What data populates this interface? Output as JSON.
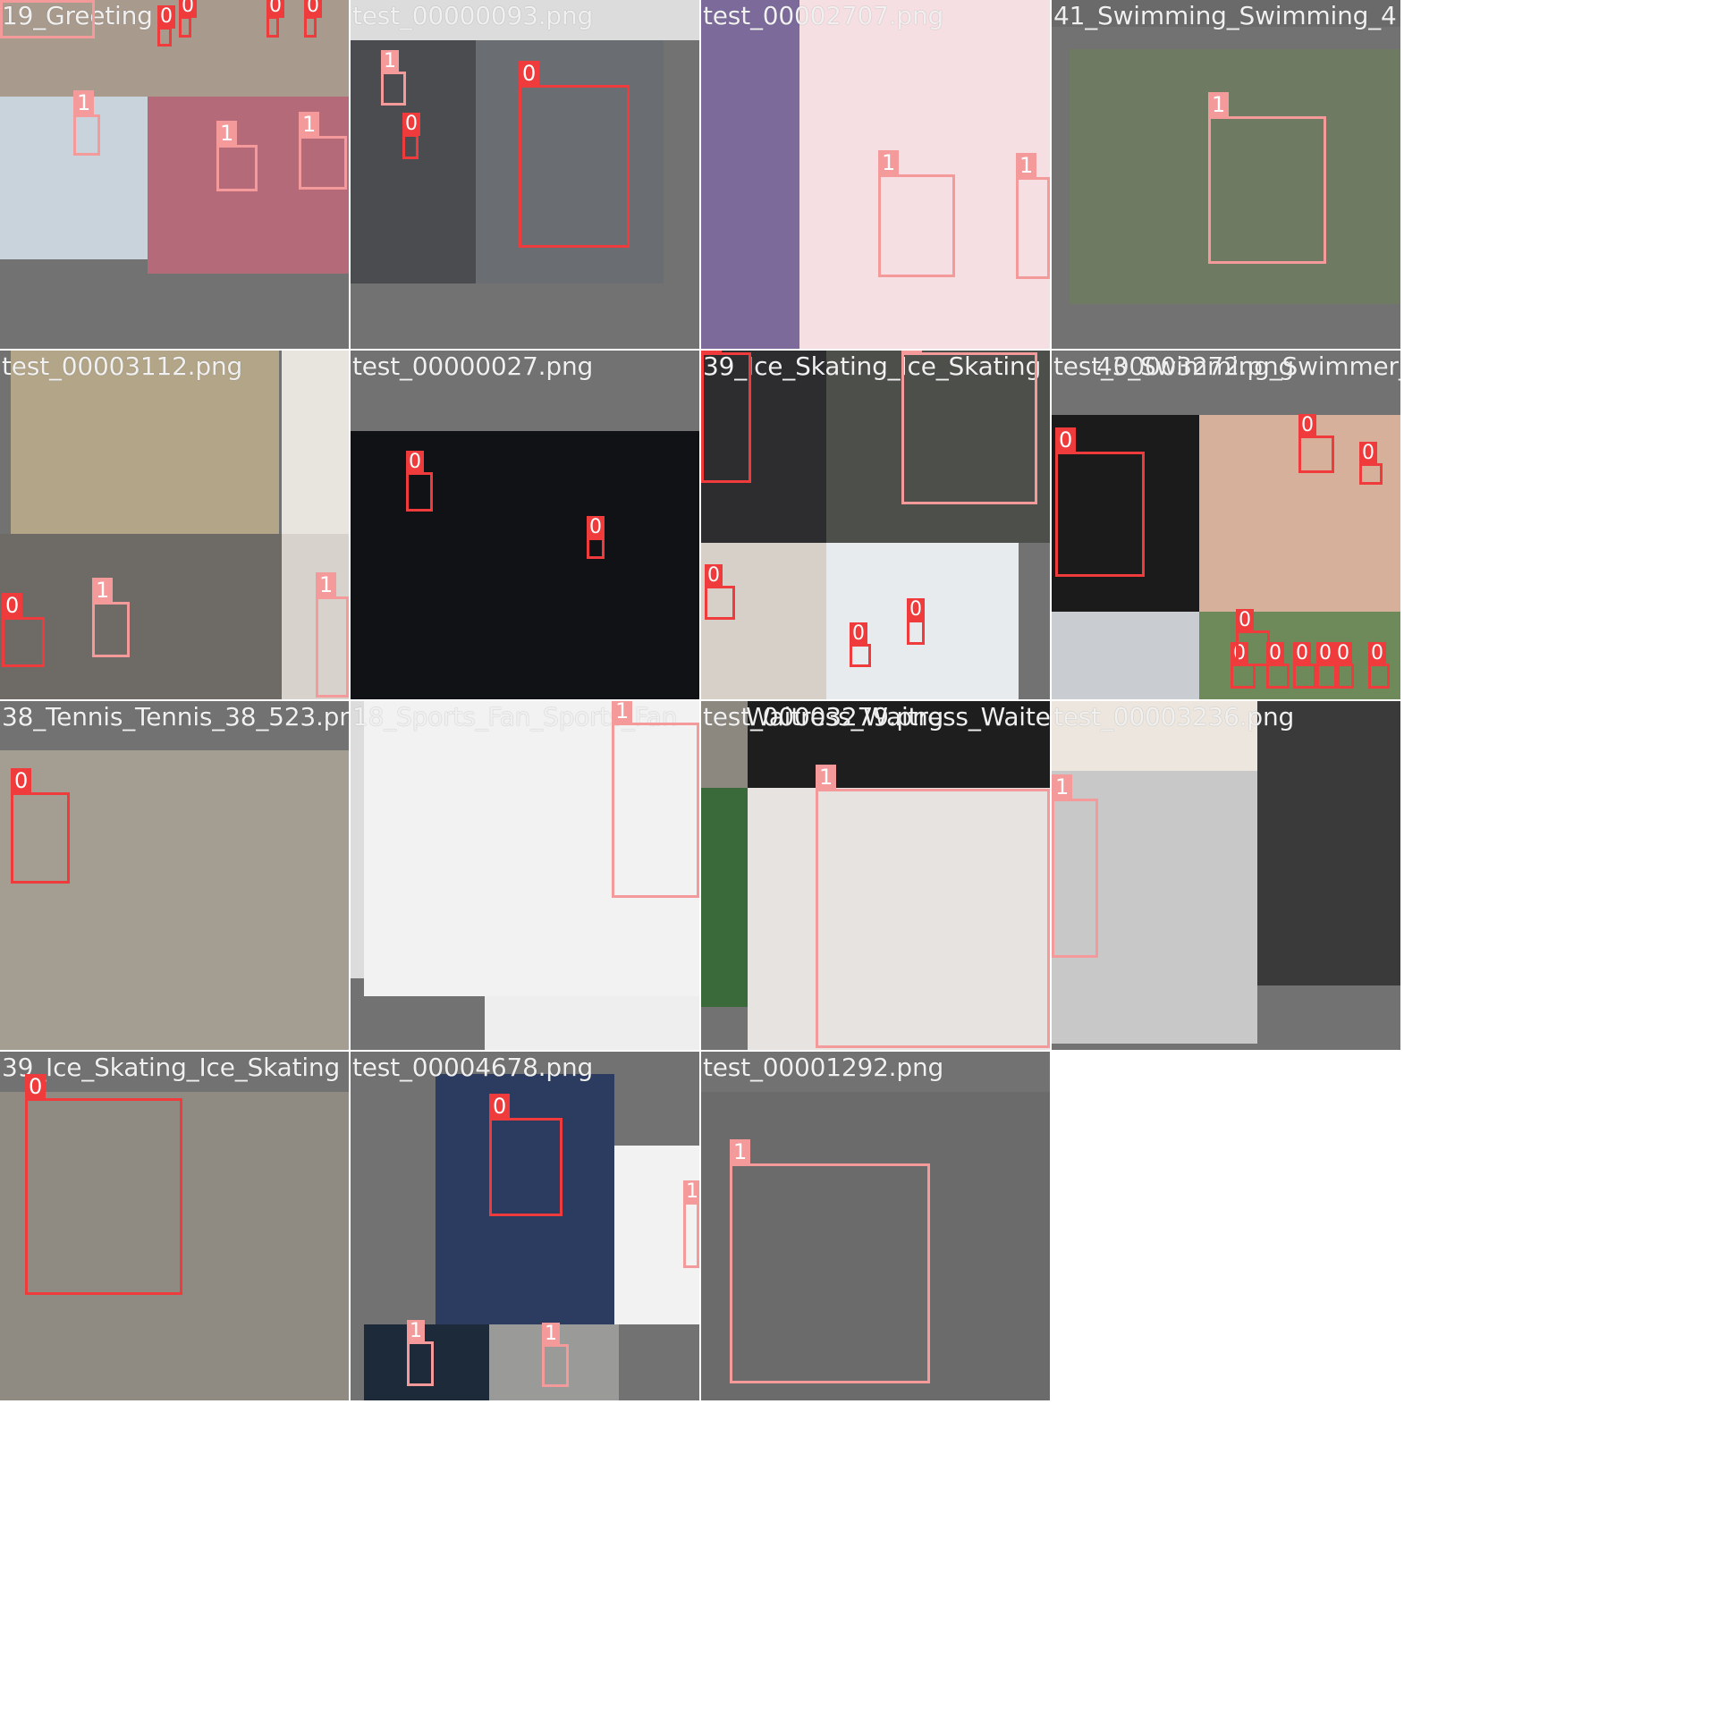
{
  "mosaic": {
    "classes": {
      "0": "0",
      "1": "1"
    },
    "colors": {
      "class_0": "#ef3b3b",
      "class_1": "#f49a9a",
      "padding_gray": "#727272"
    },
    "tiles": [
      {
        "row": 0,
        "col": 0,
        "titles": [
          "19_Greeting"
        ],
        "boxes": [
          "1",
          "0",
          "0",
          "0",
          "0",
          "0",
          "1",
          "1",
          "1"
        ]
      },
      {
        "row": 0,
        "col": 1,
        "titles": [
          "test_00000093.png"
        ],
        "boxes": [
          "1",
          "0",
          "0"
        ]
      },
      {
        "row": 0,
        "col": 2,
        "titles": [
          "test_00002707.png"
        ],
        "boxes": [
          "1",
          "1"
        ]
      },
      {
        "row": 0,
        "col": 3,
        "titles": [
          "41_Swimming_Swimming_4"
        ],
        "boxes": [
          "1"
        ]
      },
      {
        "row": 1,
        "col": 0,
        "titles": [
          "test_00003112.png"
        ],
        "boxes": [
          "0",
          "1",
          "1"
        ]
      },
      {
        "row": 1,
        "col": 1,
        "titles": [
          "test_00000027.png"
        ],
        "boxes": [
          "0",
          "0"
        ]
      },
      {
        "row": 1,
        "col": 2,
        "titles": [
          "39_Ice_Skating_Ice_Skating"
        ],
        "boxes": [
          "0",
          "1",
          "0",
          "0",
          "0"
        ]
      },
      {
        "row": 1,
        "col": 3,
        "titles": [
          "test_00003272.png",
          "43_Swimming_Swimmer_41"
        ],
        "boxes": [
          "0",
          "0",
          "0",
          "0",
          "0",
          "0",
          "0",
          "0",
          "0",
          "0"
        ]
      },
      {
        "row": 2,
        "col": 0,
        "titles": [
          "38_Tennis_Tennis_38_523.png"
        ],
        "boxes": [
          "0"
        ]
      },
      {
        "row": 2,
        "col": 1,
        "titles": [
          "18_Sports_Fan_Sports_Fan"
        ],
        "boxes": [
          "1"
        ]
      },
      {
        "row": 2,
        "col": 2,
        "titles": [
          "test_00003279.png",
          "Waitress_Waitress_Waiter"
        ],
        "boxes": [
          "1"
        ]
      },
      {
        "row": 2,
        "col": 3,
        "titles": [
          "test_00003236.png"
        ],
        "boxes": [
          "1"
        ]
      },
      {
        "row": 3,
        "col": 0,
        "titles": [
          "39_Ice_Skating_Ice_Skating"
        ],
        "boxes": [
          "0"
        ]
      },
      {
        "row": 3,
        "col": 1,
        "titles": [
          "test_00004678.png"
        ],
        "boxes": [
          "0",
          "1",
          "1",
          "1"
        ]
      },
      {
        "row": 3,
        "col": 2,
        "titles": [
          "test_00001292.png"
        ],
        "boxes": [
          "1"
        ]
      }
    ]
  }
}
